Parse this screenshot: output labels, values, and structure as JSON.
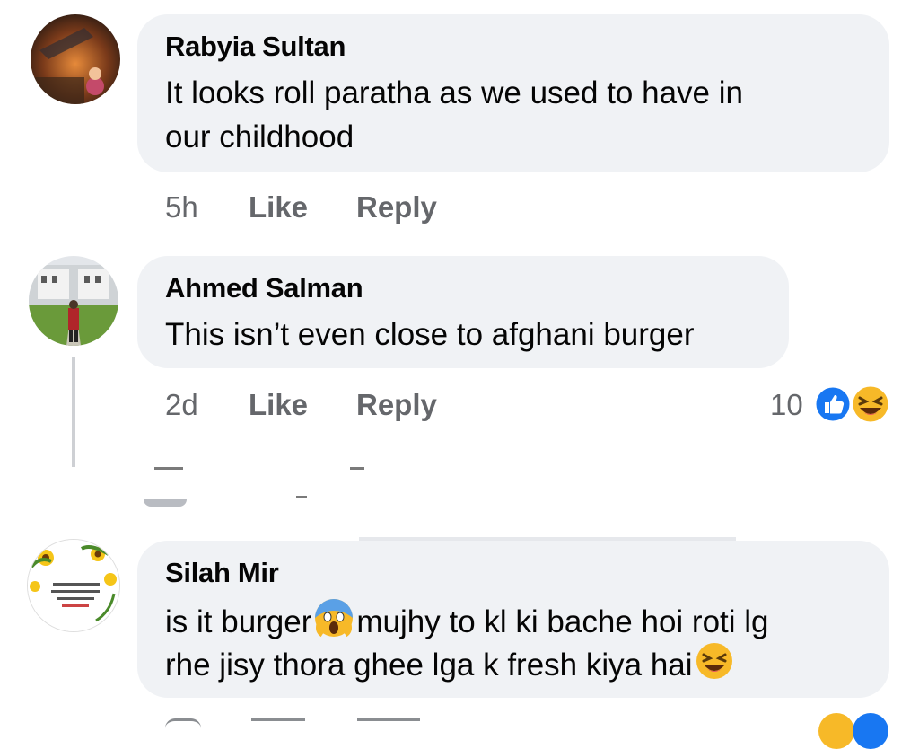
{
  "comments": [
    {
      "author": "Rabyia Sultan",
      "line1": "It looks roll paratha as we used to have in",
      "line2": "our childhood",
      "time": "5h",
      "like": "Like",
      "reply": "Reply"
    },
    {
      "author": "Ahmed Salman",
      "line1": "This isn’t even close to afghani burger",
      "time": "2d",
      "like": "Like",
      "reply": "Reply",
      "reaction_count": "10",
      "reactions": [
        "like-icon",
        "laugh-icon"
      ]
    },
    {
      "author": "Silah Mir",
      "line1_a": "is it burger",
      "line1_b": "mujhy to kl ki bache hoi roti lg",
      "line2": "rhe jisy thora ghee lga k fresh kiya hai",
      "emojis": [
        "scream-emoji-icon",
        "laugh-emoji-icon"
      ]
    }
  ],
  "colors": {
    "bubble": "#f0f2f5",
    "meta": "#65676b",
    "like_blue": "#1877f2",
    "laugh_yellow": "#f7b928"
  }
}
